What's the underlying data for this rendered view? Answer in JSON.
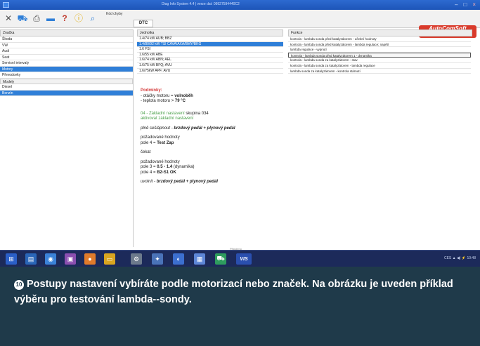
{
  "window": {
    "title": "Diag Info System 4.4 | verze dat: 09927594440C2",
    "controls": [
      "–",
      "□",
      "×"
    ]
  },
  "toolbar": {
    "error_label": "Kód chyby",
    "dtc_label": "DTC",
    "tools": [
      "tools-icon",
      "car-icon",
      "printer-icon",
      "card-icon",
      "help-icon",
      "info-icon",
      "search-icon"
    ]
  },
  "brand": {
    "name": "AutoComSoft",
    "tagline": "AUTOMOBILOVÁ DIAGNOSTIKA"
  },
  "left_pane": {
    "header": "Značka",
    "rows": [
      {
        "label": "Škoda",
        "selected": false
      },
      {
        "label": "VW",
        "selected": false
      },
      {
        "label": "Audi",
        "selected": false
      },
      {
        "label": "Seat",
        "selected": false
      },
      {
        "label": "Servisní intervaly",
        "selected": false
      },
      {
        "label": "Motory",
        "selected": true
      },
      {
        "label": "Převodovky",
        "selected": false
      }
    ],
    "group_header": "Modely",
    "group_rows": [
      {
        "label": "Diesel",
        "selected": false
      },
      {
        "label": "Benzín",
        "selected": true
      }
    ]
  },
  "mid_pane": {
    "header": "Jednotka",
    "rows": [
      {
        "label": "1.4/74 kW AUB; BBZ",
        "selected": false
      },
      {
        "label": "1.4/80/92 kW TSI CAVA/AXA/BMY/BKG",
        "selected": true
      },
      {
        "label": "1.6 FSI",
        "selected": false
      },
      {
        "label": "1.6/55 kW ABE",
        "selected": false
      },
      {
        "label": "1.6/74 kW ABN; AEL",
        "selected": false
      },
      {
        "label": "1.6/75 kW BFQ; AVU",
        "selected": false
      },
      {
        "label": "1.6/75kW APF; AVU",
        "selected": false
      }
    ]
  },
  "right_pane": {
    "header": "Funkce",
    "rows": [
      {
        "label": "kontrola - lambda sonda před katalyzátorem - učební hodnoty",
        "selected": false
      },
      {
        "label": "kontrola - lambda sonda před katalyzátorem - lambda regulace; napětí",
        "selected": false
      },
      {
        "label": "lambda regulace - vypnutí",
        "selected": false
      },
      {
        "label": "kontrola - lambda sonda před katalyzátorem 1 - dynamika",
        "selected": true
      },
      {
        "label": "kontrola - lambda sonda za katalyzátorem - stav",
        "selected": false
      },
      {
        "label": "kontrola - lambda sonda za katalyzátorem - lambda regulace",
        "selected": false
      },
      {
        "label": "lambda sonda za katalyzátorem - kontrola stárnutí",
        "selected": false
      }
    ]
  },
  "detail": {
    "conditions_title": "Podmínky:",
    "cond1_prefix": "- otáčky motoru = ",
    "cond1_value": "volnoběh",
    "cond2_prefix": "- teplota motoru > ",
    "cond2_value": "79 °C",
    "setting_green": "04 - Základní nastavení",
    "setting_group": " skupina 034",
    "setting_sub": "aktivovat základní nastavení",
    "press_prefix": "plně sešlápnout - ",
    "press_value": "brzdový pedál + plynový pedál",
    "req1": "požadované hodnoty",
    "req1_field_prefix": "pole 4 = ",
    "req1_field_value": "Test Zap",
    "wait": "čekat",
    "req2": "požadované hodnoty",
    "req2_field1_prefix": "pole 3 = ",
    "req2_field1_value": "0.5 - 1.4",
    "req2_field1_suffix": " (dynamika)",
    "req2_field2_prefix": "pole 4 = ",
    "req2_field2_value": "B2-S1 OK",
    "release_prefix": "uvolnit - ",
    "release_value": "brzdový pedál + plynový pedál"
  },
  "status_label": "Připojeno",
  "taskbar": {
    "items": [
      "windows-icon",
      "explorer-icon",
      "browser-icon",
      "photos-icon",
      "firefox-icon",
      "folder-icon",
      "settings-icon",
      "tool-icon",
      "media-icon",
      "calendar-icon",
      "car-diag-icon",
      "vis-icon"
    ],
    "vis_label": "VIS",
    "tray": "CES  ▲  ◀)  ⚡  10:48"
  },
  "caption": {
    "number": "10",
    "text": "Postupy nastavení vybíráte podle motorizací nebo značek. Na obrázku je uveden příklad výběru pro testování lambda--sondy."
  },
  "colors": {
    "selection": "#2f7fd8",
    "brand": "#d93a2b",
    "caption_bg": "#1f3a4a",
    "taskbar": "#1c2a5a"
  }
}
